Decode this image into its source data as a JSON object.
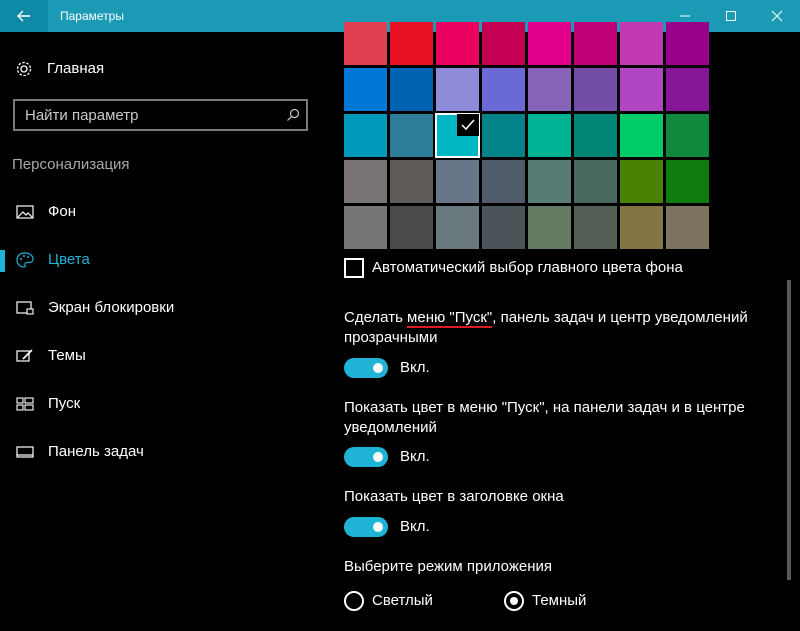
{
  "window": {
    "title": "Параметры"
  },
  "sidebar": {
    "home_label": "Главная",
    "search_placeholder": "Найти параметр",
    "section_title": "Персонализация",
    "items": [
      {
        "label": "Фон",
        "icon": "image-icon"
      },
      {
        "label": "Цвета",
        "icon": "palette-icon",
        "active": true
      },
      {
        "label": "Экран блокировки",
        "icon": "lock-screen-icon"
      },
      {
        "label": "Темы",
        "icon": "brush-icon"
      },
      {
        "label": "Пуск",
        "icon": "start-icon"
      },
      {
        "label": "Панель задач",
        "icon": "taskbar-icon"
      }
    ]
  },
  "colors": {
    "accent": "#1fb3d6",
    "swatch_rows": [
      [
        "#e0404f",
        "#e81123",
        "#ea005e",
        "#c30052",
        "#e3008c",
        "#bf0077",
        "#c239b3",
        "#9a0089"
      ],
      [
        "#0078d7",
        "#0063b1",
        "#8e8cd8",
        "#6b69d6",
        "#8764b8",
        "#744da9",
        "#b146c2",
        "#881798"
      ],
      [
        "#0099bc",
        "#2d7d9a",
        "#00b7c3",
        "#038387",
        "#00b294",
        "#018574",
        "#00cc6a",
        "#10893e"
      ],
      [
        "#7a7574",
        "#5d5a58",
        "#68768a",
        "#515c6b",
        "#567c73",
        "#486860",
        "#498205",
        "#107c10"
      ],
      [
        "#767676",
        "#4c4a48",
        "#69797e",
        "#4a5459",
        "#647c64",
        "#525e54",
        "#847545",
        "#7e735f"
      ]
    ],
    "selected_row": 2,
    "selected_col": 2
  },
  "main": {
    "auto_label": "Автоматический выбор главного цвета фона",
    "transparency_label_pre": "Сделать ",
    "transparency_label_underlined": "меню \"Пуск\"",
    "transparency_label_post": ", панель задач и центр уведомлений прозрачными",
    "transparency_state": "Вкл.",
    "show_start_label": "Показать цвет в меню \"Пуск\", на панели задач и в центре уведомлений",
    "show_start_state": "Вкл.",
    "show_title_label": "Показать цвет в заголовке окна",
    "show_title_state": "Вкл.",
    "app_mode_label": "Выберите режим приложения",
    "mode_light": "Светлый",
    "mode_dark": "Темный",
    "mode_selected": "Темный"
  }
}
